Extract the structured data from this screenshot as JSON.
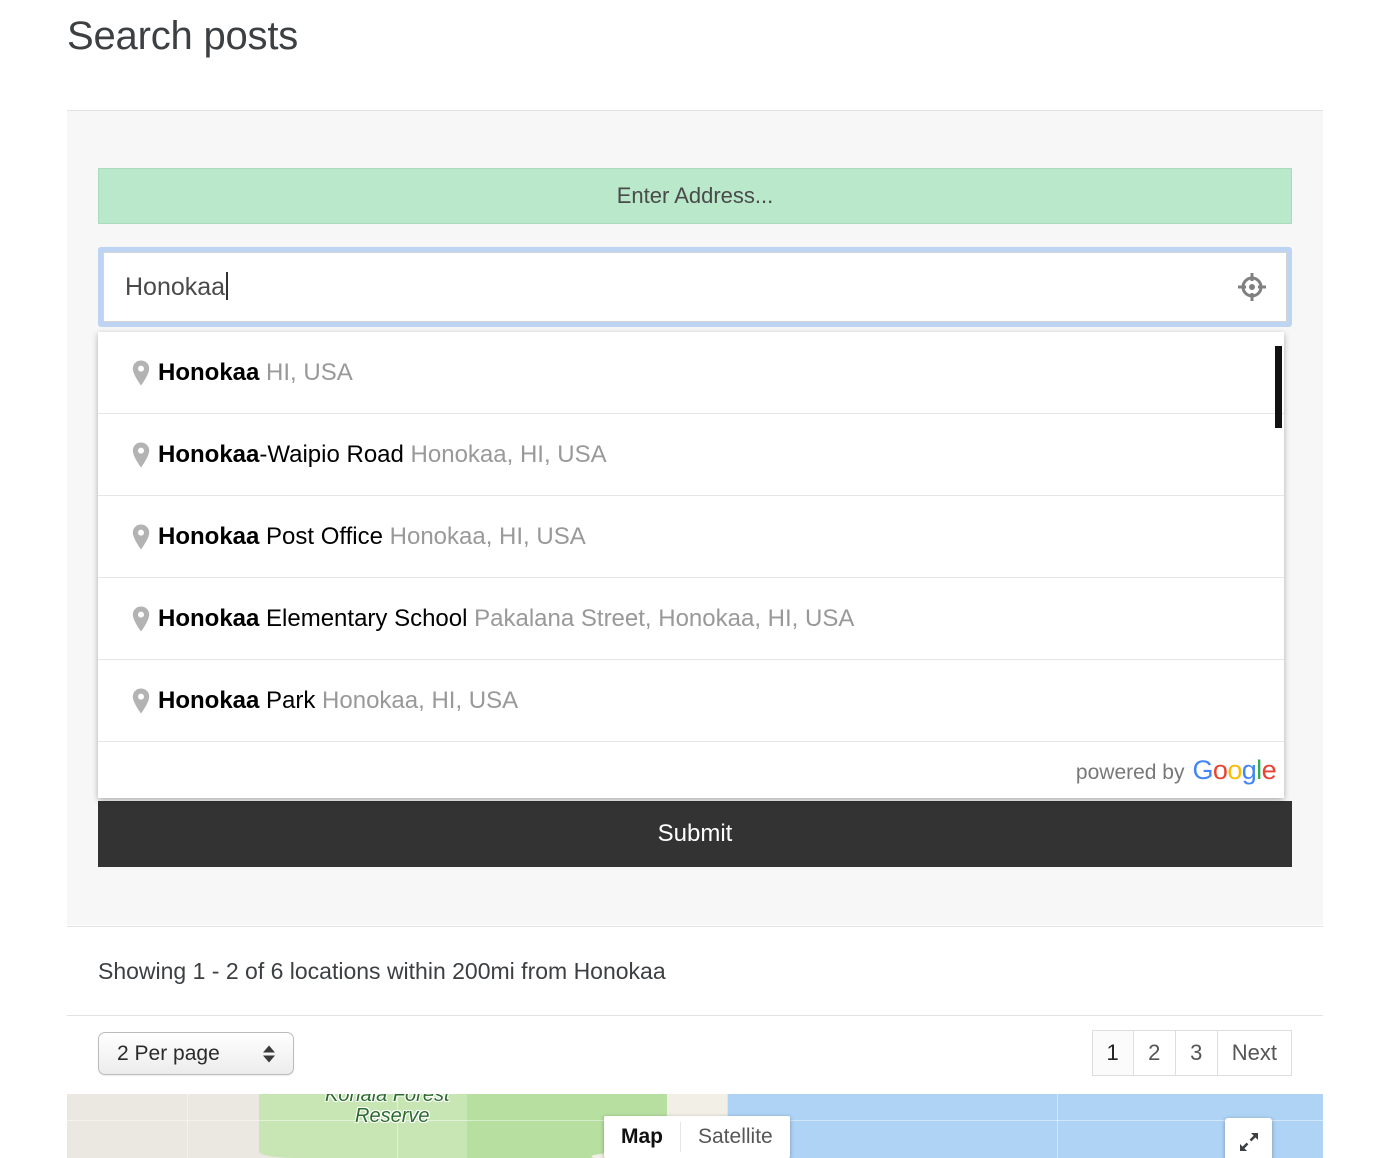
{
  "page": {
    "title": "Search posts"
  },
  "search_form": {
    "address_banner_label": "Enter Address...",
    "address_input_value": "Honokaa",
    "address_input_placeholder": "Enter Address...",
    "geolocate_icon": "crosshair-icon",
    "submit_label": "Submit"
  },
  "autocomplete": {
    "pin_icon": "map-pin-icon",
    "items": [
      {
        "main_bold": "Honokaa",
        "main_rest": "",
        "secondary": "HI, USA"
      },
      {
        "main_bold": "Honokaa",
        "main_rest": "-Waipio Road",
        "secondary": "Honokaa, HI, USA"
      },
      {
        "main_bold": "Honokaa",
        "main_rest": " Post Office",
        "secondary": "Honokaa, HI, USA"
      },
      {
        "main_bold": "Honokaa",
        "main_rest": " Elementary School",
        "secondary": "Pakalana Street, Honokaa, HI, USA"
      },
      {
        "main_bold": "Honokaa",
        "main_rest": " Park",
        "secondary": "Honokaa, HI, USA"
      }
    ],
    "footer": {
      "powered_by_text": "powered by",
      "brand_letters": [
        "G",
        "o",
        "o",
        "g",
        "l",
        "e"
      ],
      "brand_colors": [
        "#4285F4",
        "#EA4335",
        "#FBBC05",
        "#4285F4",
        "#34A853",
        "#EA4335"
      ]
    }
  },
  "results": {
    "summary": "Showing 1 - 2 of 6 locations within 200mi from Honokaa"
  },
  "pager": {
    "per_page_label": "2 Per page",
    "pages": [
      {
        "label": "1",
        "active": true
      },
      {
        "label": "2",
        "active": false
      },
      {
        "label": "3",
        "active": false
      },
      {
        "label": "Next",
        "active": false
      }
    ]
  },
  "map": {
    "label_line1": "Kohala Forest",
    "label_line2": "Reserve",
    "map_type_map": "Map",
    "map_type_satellite": "Satellite",
    "fullscreen_icon": "expand-icon",
    "colors": {
      "water": "#aed3f4",
      "land": "#ebe8e2",
      "forest": "#c8e6b4",
      "label_text": "#2c6b2e"
    }
  }
}
